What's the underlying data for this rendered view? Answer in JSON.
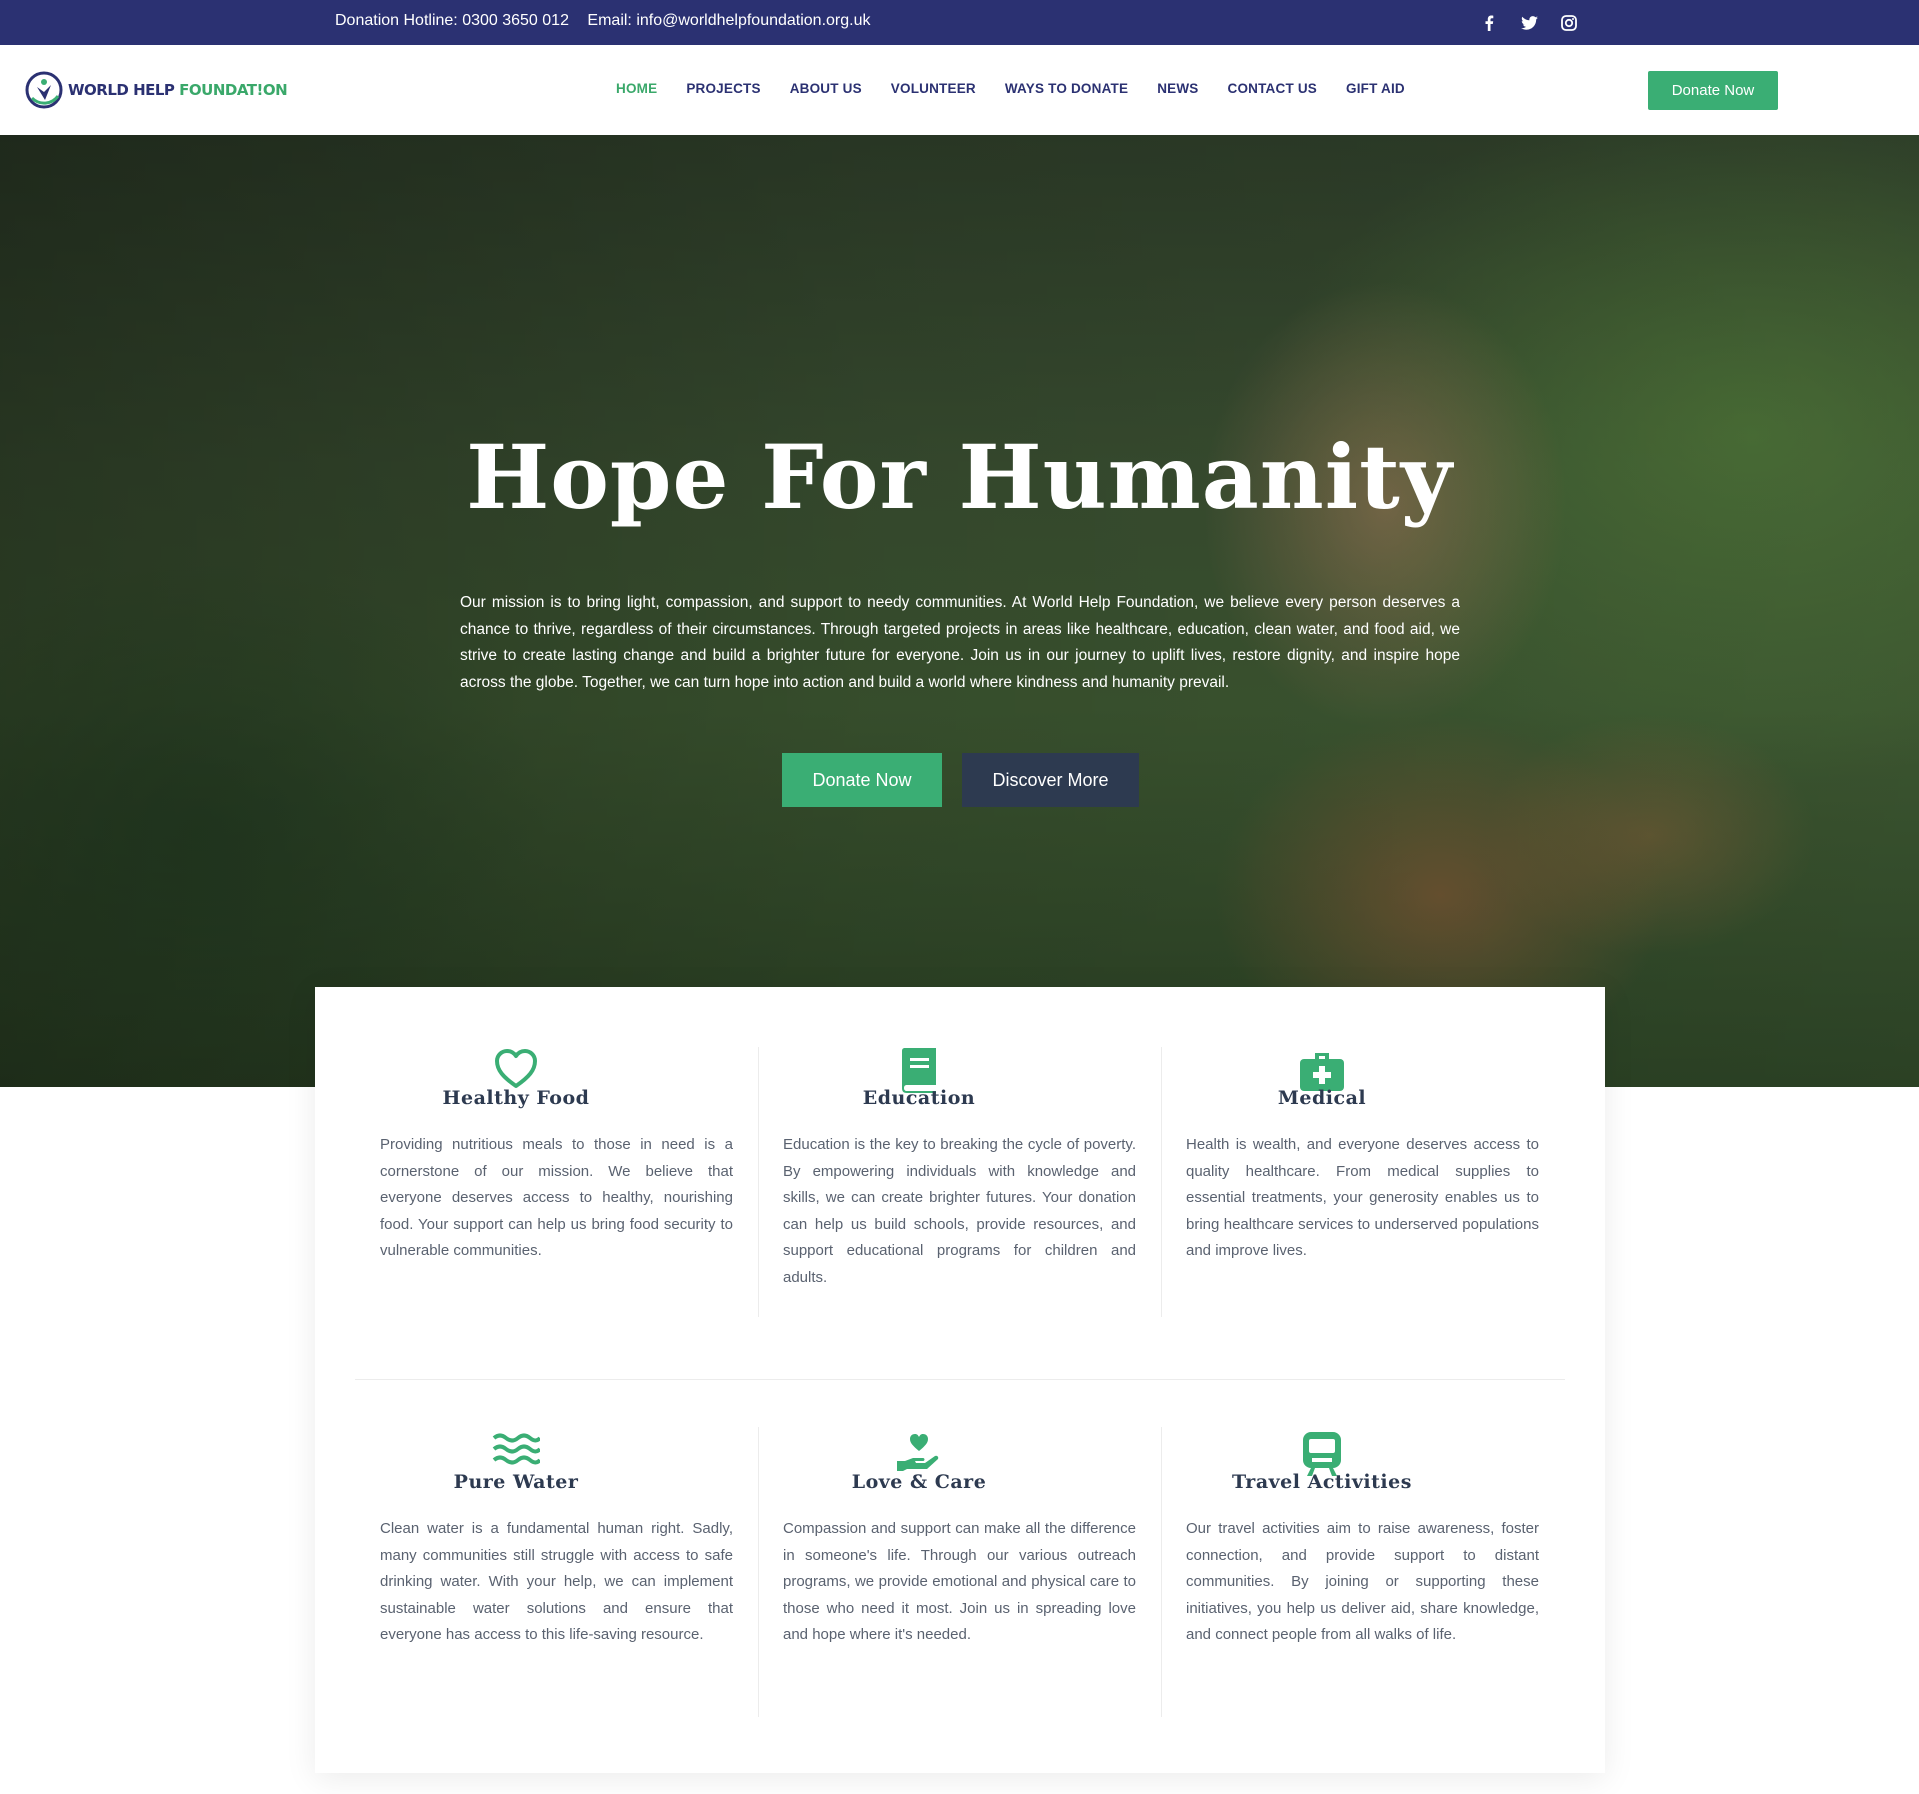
{
  "topbar": {
    "hotline": "Donation Hotline: 0300 3650 012",
    "email": "Email: info@worldhelpfoundation.org.uk",
    "socials": [
      "facebook-icon",
      "twitter-icon",
      "instagram-icon"
    ]
  },
  "header": {
    "logo_text_main": "WORLD HELP ",
    "logo_text_accent": "FOUNDAT!ON",
    "nav": [
      "HOME",
      "PROJECTS",
      "ABOUT US",
      "VOLUNTEER",
      "WAYS TO DONATE",
      "NEWS",
      "CONTACT US",
      "GIFT AID"
    ],
    "active_nav": "HOME",
    "donate_label": "Donate Now"
  },
  "hero": {
    "title": "Hope For Humanity",
    "text": "Our mission is to bring light, compassion, and support to needy communities. At World Help Foundation, we believe every person deserves a chance to thrive, regardless of their circumstances. Through targeted projects in areas like healthcare, education, clean water, and food aid, we strive to create lasting change and build a brighter future for everyone. Join us in our journey to uplift lives, restore dignity, and inspire hope across the globe. Together, we can turn hope into action and build a world where kindness and humanity prevail.",
    "donate_label": "Donate Now",
    "discover_label": "Discover More"
  },
  "cards": [
    {
      "icon": "heart-icon",
      "title": "Healthy Food",
      "text": "Providing nutritious meals to those in need is a cornerstone of our mission. We believe that everyone deserves access to healthy, nourishing food. Your support can help us bring food security to vulnerable communities."
    },
    {
      "icon": "book-icon",
      "title": "Education",
      "text": "Education is the key to breaking the cycle of poverty. By empowering individuals with knowledge and skills, we can create brighter futures. Your donation can help us build schools, provide resources, and support educational programs for children and adults."
    },
    {
      "icon": "medical-kit-icon",
      "title": "Medical",
      "text": "Health is wealth, and everyone deserves access to quality healthcare. From medical supplies to essential treatments, your generosity enables us to bring healthcare services to underserved populations and improve lives."
    },
    {
      "icon": "water-icon",
      "title": "Pure Water",
      "text": "Clean water is a fundamental human right. Sadly, many communities still struggle with access to safe drinking water. With your help, we can implement sustainable water solutions and ensure that everyone has access to this life-saving resource."
    },
    {
      "icon": "hand-heart-icon",
      "title": "Love & Care",
      "text": "Compassion and support can make all the difference in someone's life. Through our various outreach programs, we provide emotional and physical care to those who need it most. Join us in spreading love and hope where it's needed."
    },
    {
      "icon": "train-icon",
      "title": "Travel Activities",
      "text": "Our travel activities aim to raise awareness, foster connection, and provide support to distant communities. By joining or supporting these initiatives, you help us deliver aid, share knowledge, and connect people from all walks of life."
    }
  ],
  "colors": {
    "brand_blue": "#2b3172",
    "brand_green": "#3aae74",
    "dark_button": "#2d3a50"
  }
}
